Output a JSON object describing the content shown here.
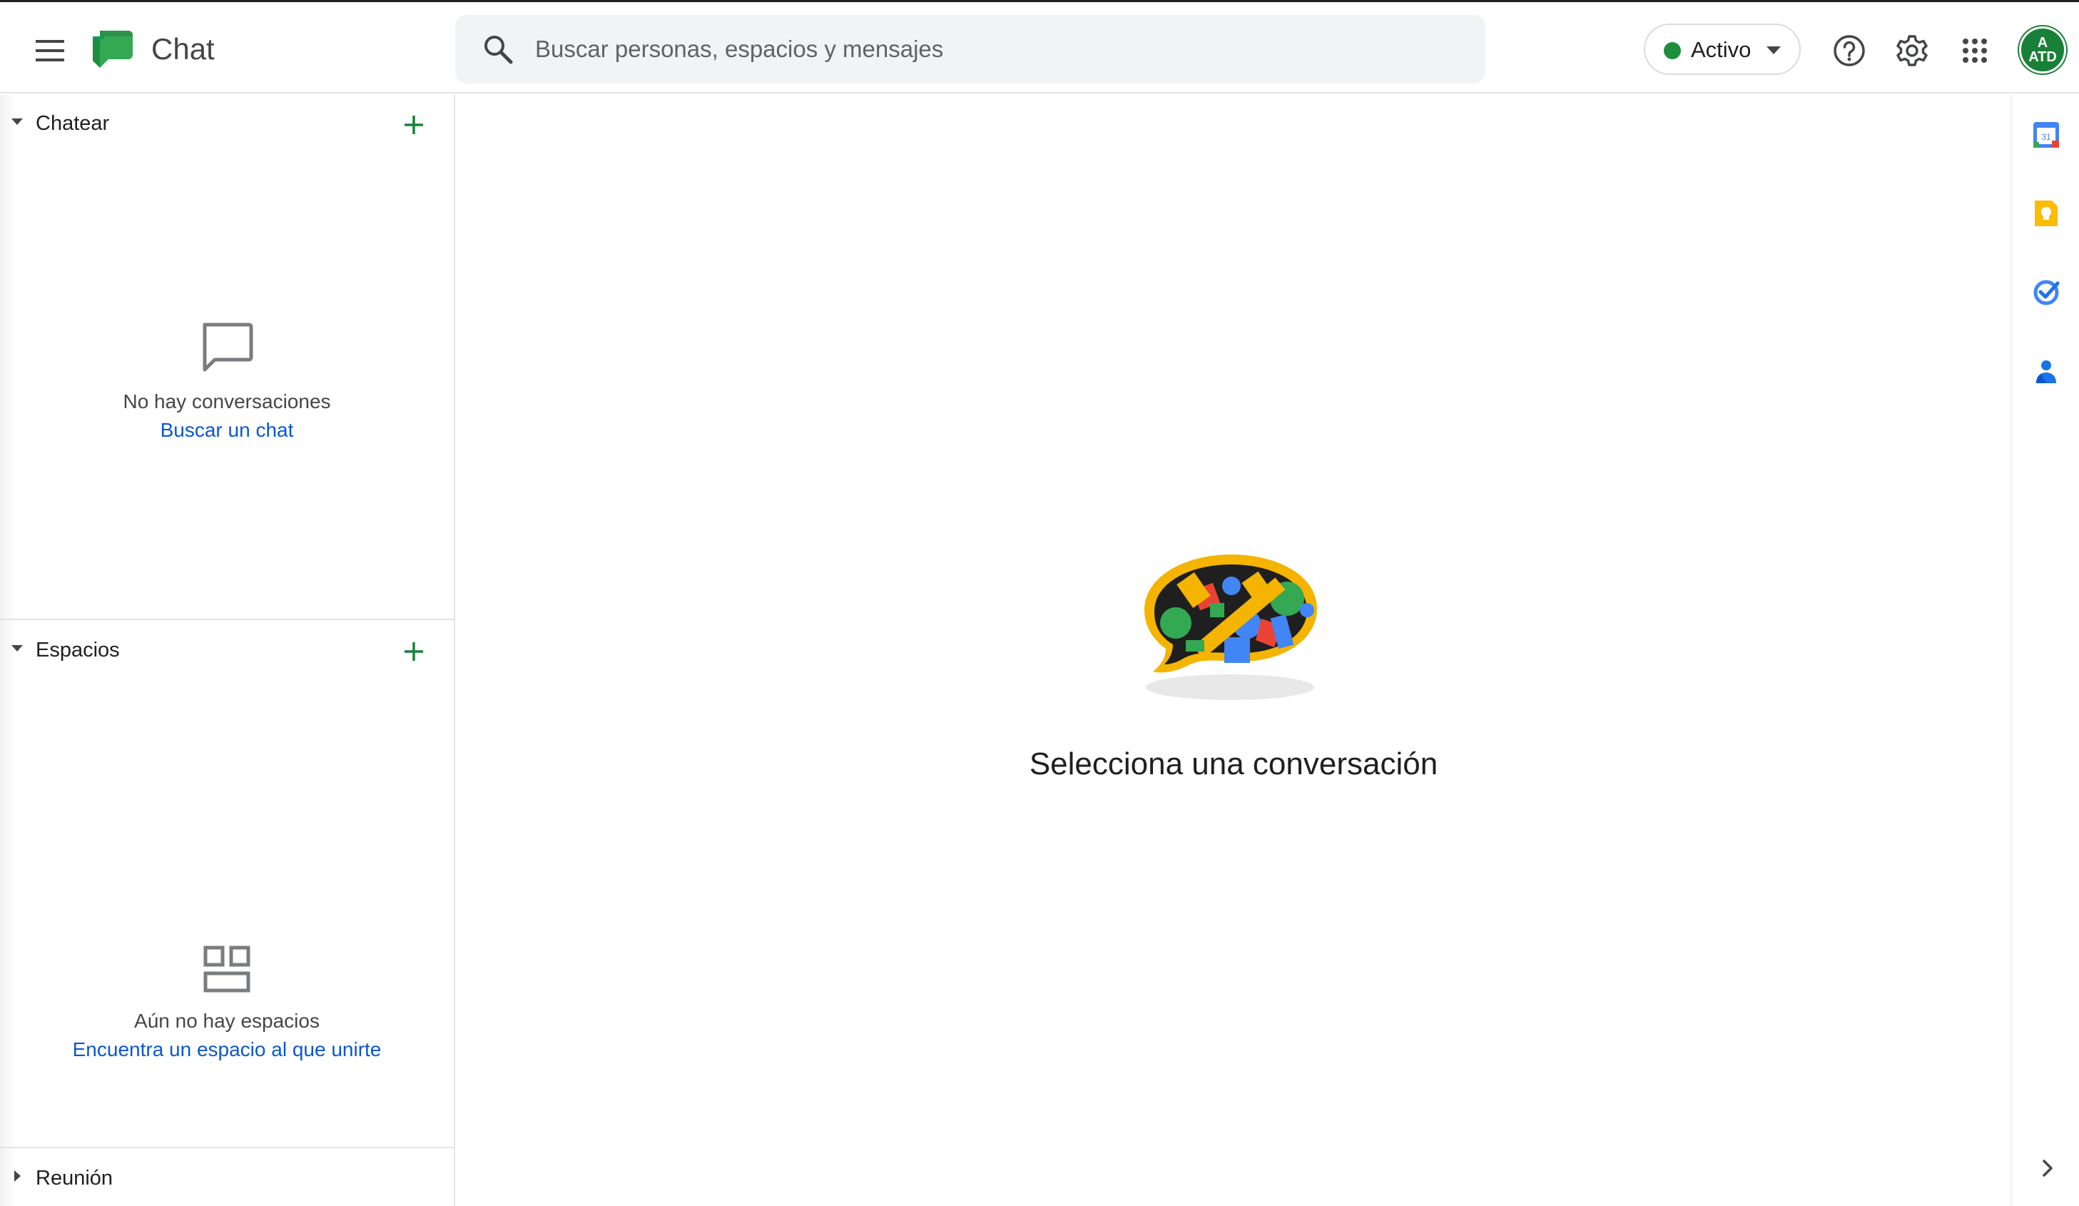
{
  "header": {
    "app_title": "Chat",
    "search_placeholder": "Buscar personas, espacios y mensajes",
    "status_label": "Activo",
    "avatar_line1": "A",
    "avatar_line2": "ATD"
  },
  "sidebar": {
    "chat": {
      "title": "Chatear",
      "empty_text": "No hay conversaciones",
      "empty_link": "Buscar un chat"
    },
    "spaces": {
      "title": "Espacios",
      "empty_text": "Aún no hay espacios",
      "empty_link": "Encuentra un espacio al que unirte"
    },
    "meet": {
      "title": "Reunión"
    }
  },
  "main": {
    "title": "Selecciona una conversación"
  },
  "rail": {
    "calendar_day": "31"
  },
  "colors": {
    "accent_green": "#188038",
    "status_green": "#1e8e3e",
    "link_blue": "#0b57d0",
    "search_bg": "#f1f3f4"
  },
  "icons": [
    "menu-icon",
    "chat-logo-icon",
    "search-icon",
    "help-icon",
    "settings-icon",
    "apps-grid-icon",
    "add-icon",
    "chat-bubble-icon",
    "spaces-grid-icon",
    "calendar-icon",
    "keep-icon",
    "tasks-icon",
    "contacts-icon",
    "chevron-right-icon"
  ]
}
